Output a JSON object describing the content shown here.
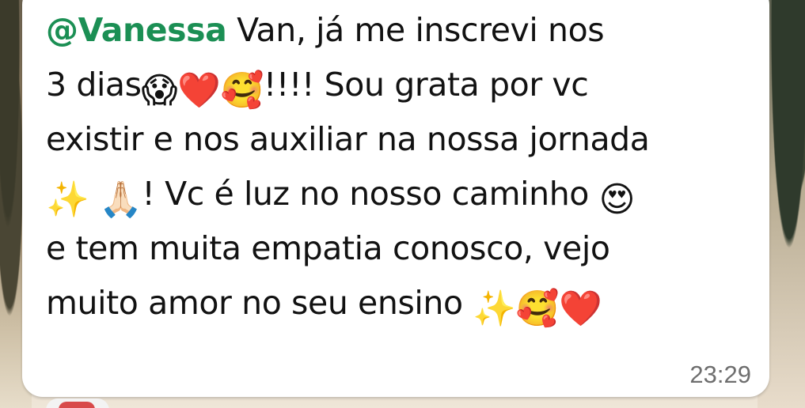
{
  "message": {
    "mention": "@Vanessa",
    "segments": {
      "s1": " Van, já me inscrevi nos",
      "s2": "3 dias",
      "s3": "!!!! Sou grata por vc",
      "s4": "existir e nos auxiliar na nossa jornada",
      "s5": "! Vc é luz no nosso caminho ",
      "s6": "e tem muita empatia conosco, vejo",
      "s7": "muito amor no seu ensino "
    },
    "emojis": {
      "screaming": "😱",
      "red_heart": "❤️",
      "smiling_hearts": "🥰",
      "sparkles": "✨",
      "folded_hands": "🙏🏻",
      "heart_eyes": "😍"
    },
    "time": "23:29"
  },
  "colors": {
    "mention": "#1b8f54",
    "bubble": "#ffffff",
    "time": "#6e6e6e"
  }
}
